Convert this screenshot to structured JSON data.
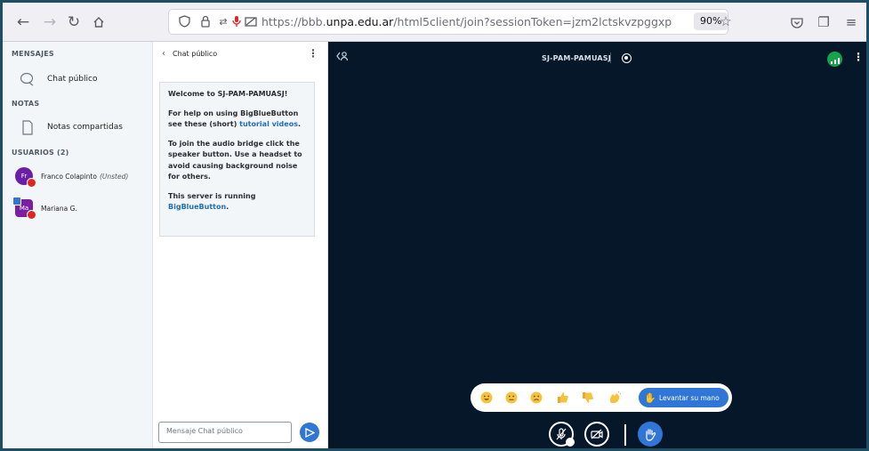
{
  "browser": {
    "url_prefix": "https://bbb.",
    "url_domain": "unpa.edu.ar",
    "url_path": "/html5client/join?sessionToken=jzm2lctskvzpggxp",
    "zoom": "90%"
  },
  "sidebar": {
    "messages_header": "MENSAJES",
    "public_chat_label": "Chat público",
    "notes_header": "NOTAS",
    "shared_notes_label": "Notas compartidas",
    "users_header": "USUARIOS (2)",
    "users": [
      {
        "initials": "Fr",
        "name": "Franco Colapinto",
        "tag": "(Unsted)",
        "color": "#6a1fa8"
      },
      {
        "initials": "Ma",
        "name": "Mariana G.",
        "tag": "",
        "color": "#7b1fa2"
      }
    ]
  },
  "chat": {
    "title": "Chat público",
    "welcome_title": "Welcome to SJ-PAM-PAMUASJ!",
    "help_text": "For help on using BigBlueButton see these (short) ",
    "help_link": "tutorial videos",
    "help_end": ".",
    "audio_text": "To join the audio bridge click the speaker button. Use a headset to avoid causing background noise for others.",
    "server_text": "This server is running ",
    "server_link": "BigBlueButton",
    "server_end": ".",
    "input_placeholder": "Mensaje Chat público"
  },
  "main": {
    "meeting_title": "SJ-PAM-PAMUASJ",
    "raise_hand_label": "Levantar su mano",
    "background": "#06172a",
    "accent": "#2f76d6"
  }
}
